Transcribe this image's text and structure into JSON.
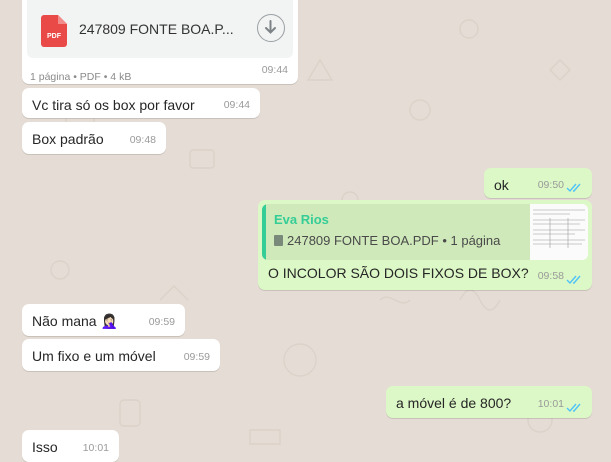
{
  "chat": {
    "document": {
      "filename": "247809 FONTE BOA.P...",
      "meta": "1 página • PDF • 4 kB",
      "time": "09:44",
      "icon": "pdf-icon",
      "pdf_badge": "PDF"
    },
    "messages": [
      {
        "text": "Vc tira só os box por favor",
        "time": "09:44",
        "direction": "in"
      },
      {
        "text": "Box padrão",
        "time": "09:48",
        "direction": "in"
      },
      {
        "text": "ok",
        "time": "09:50",
        "direction": "out"
      },
      {
        "text": "O INCOLOR SÃO DOIS FIXOS DE BOX?",
        "time": "09:58",
        "direction": "out"
      },
      {
        "text": "Não mana 🤦🏻‍♀️",
        "time": "09:59",
        "direction": "in"
      },
      {
        "text": "Um fixo e um móvel",
        "time": "09:59",
        "direction": "in"
      },
      {
        "text": "a móvel é de 800?",
        "time": "10:01",
        "direction": "out"
      },
      {
        "text": "Isso",
        "time": "10:01",
        "direction": "in"
      }
    ],
    "reply_quote": {
      "author": "Eva Rios",
      "text": "247809 FONTE BOA.PDF • 1 página"
    }
  },
  "colors": {
    "background": "#e5ddd5",
    "incoming": "#ffffff",
    "outgoing": "#dcf8c6",
    "read_ticks": "#4fc3f7",
    "quote_author": "#35cd96",
    "pdf_red": "#e94a47"
  }
}
